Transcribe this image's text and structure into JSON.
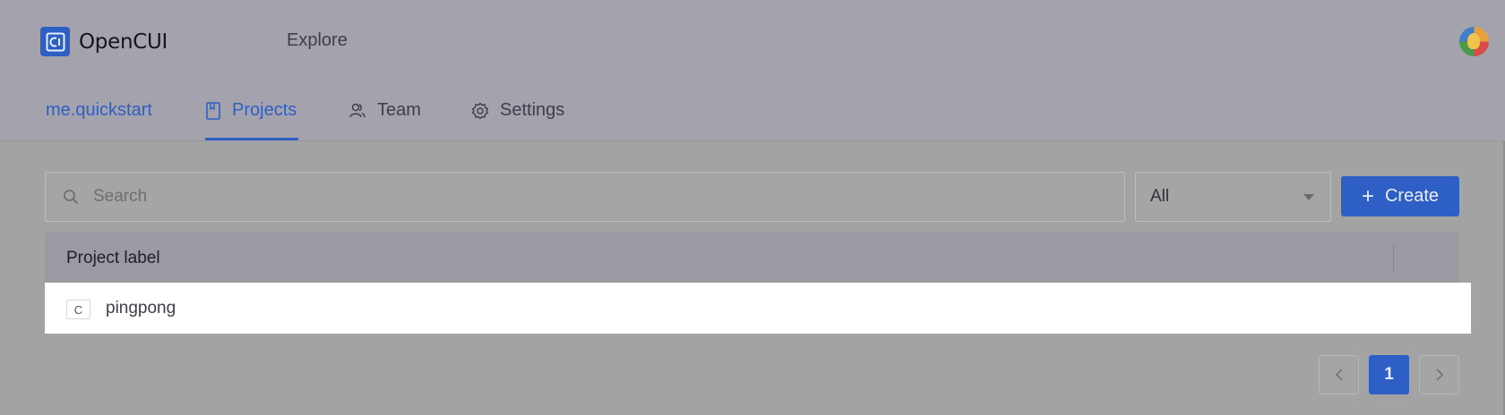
{
  "app": {
    "name": "OpenCUI",
    "brand_color": "#2d5fc4"
  },
  "header": {
    "explore_label": "Explore",
    "avatar_icon": "user-avatar-icon"
  },
  "nav": {
    "workspace": "me.quickstart",
    "tabs": [
      {
        "label": "Projects",
        "icon": "book-icon",
        "active": true
      },
      {
        "label": "Team",
        "icon": "team-icon",
        "active": false
      },
      {
        "label": "Settings",
        "icon": "gear-icon",
        "active": false
      }
    ]
  },
  "toolbar": {
    "search_placeholder": "Search",
    "filter_value": "All",
    "create_label": "Create"
  },
  "table": {
    "columns": [
      "Project label"
    ],
    "rows": [
      {
        "badge": "C",
        "label": "pingpong"
      }
    ]
  },
  "pagination": {
    "current_page": "1"
  }
}
